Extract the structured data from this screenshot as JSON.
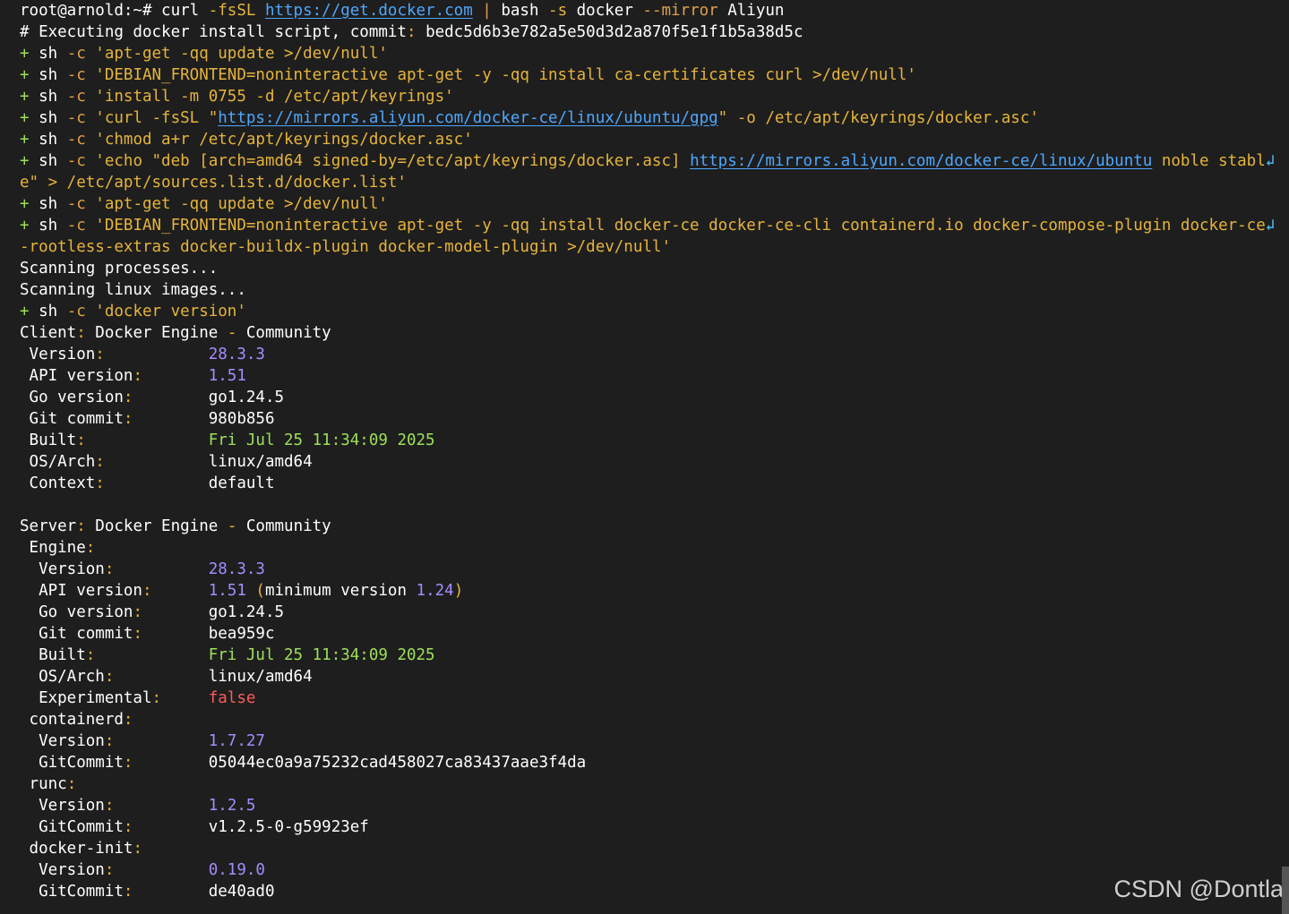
{
  "terminal": {
    "lines": [
      [
        [
          "root@arnold:~# curl ",
          "w"
        ],
        [
          "-fsSL ",
          "g"
        ],
        [
          "https://get.docker.com",
          "ln"
        ],
        [
          " | ",
          "o"
        ],
        [
          "bash ",
          "w"
        ],
        [
          "-s ",
          "g"
        ],
        [
          "docker ",
          "w"
        ],
        [
          "--mirror ",
          "o"
        ],
        [
          "Aliyun",
          "w"
        ]
      ],
      [
        [
          "# Executing docker install script, commit",
          "w"
        ],
        [
          ": ",
          "g"
        ],
        [
          "bedc5d6b3e782a5e50d3d2a870f5e1f1b5a38d5c",
          "w"
        ]
      ],
      [
        [
          "+ ",
          "gr"
        ],
        [
          "sh ",
          "w"
        ],
        [
          "-c ",
          "o"
        ],
        [
          "'apt-get -qq update >/dev/null'",
          "g"
        ]
      ],
      [
        [
          "+ ",
          "gr"
        ],
        [
          "sh ",
          "w"
        ],
        [
          "-c ",
          "o"
        ],
        [
          "'DEBIAN_FRONTEND=noninteractive apt-get -y -qq install ca-certificates curl >/dev/null'",
          "g"
        ]
      ],
      [
        [
          "+ ",
          "gr"
        ],
        [
          "sh ",
          "w"
        ],
        [
          "-c ",
          "o"
        ],
        [
          "'install -m 0755 -d /etc/apt/keyrings'",
          "g"
        ]
      ],
      [
        [
          "+ ",
          "gr"
        ],
        [
          "sh ",
          "w"
        ],
        [
          "-c ",
          "o"
        ],
        [
          "'curl -fsSL \"",
          "g"
        ],
        [
          "https://mirrors.aliyun.com/docker-ce/linux/ubuntu/gpg",
          "ln"
        ],
        [
          "\" -o /etc/apt/keyrings/docker.asc'",
          "g"
        ]
      ],
      [
        [
          "+ ",
          "gr"
        ],
        [
          "sh ",
          "w"
        ],
        [
          "-c ",
          "o"
        ],
        [
          "'chmod a+r /etc/apt/keyrings/docker.asc'",
          "g"
        ]
      ],
      [
        [
          "+ ",
          "gr"
        ],
        [
          "sh ",
          "w"
        ],
        [
          "-c ",
          "o"
        ],
        [
          "'echo \"deb [arch=amd64 signed-by=/etc/apt/keyrings/docker.asc] ",
          "g"
        ],
        [
          "https://mirrors.aliyun.com/docker-ce/linux/ubuntu",
          "ln"
        ],
        [
          " noble stabl",
          "g"
        ],
        [
          "↲",
          "wrapmark"
        ]
      ],
      [
        [
          "e\" > /etc/apt/sources.list.d/docker.list'",
          "g"
        ]
      ],
      [
        [
          "+ ",
          "gr"
        ],
        [
          "sh ",
          "w"
        ],
        [
          "-c ",
          "o"
        ],
        [
          "'apt-get -qq update >/dev/null'",
          "g"
        ]
      ],
      [
        [
          "+ ",
          "gr"
        ],
        [
          "sh ",
          "w"
        ],
        [
          "-c ",
          "o"
        ],
        [
          "'DEBIAN_FRONTEND=noninteractive apt-get -y -qq install docker-ce docker-ce-cli containerd.io docker-compose-plugin docker-ce",
          "g"
        ],
        [
          "↲",
          "wrapmark"
        ]
      ],
      [
        [
          "-rootless-extras docker-buildx-plugin docker-model-plugin >/dev/null'",
          "g"
        ]
      ],
      [
        [
          "Scanning processes...",
          "w"
        ]
      ],
      [
        [
          "Scanning linux images...",
          "w"
        ]
      ],
      [
        [
          "+ ",
          "gr"
        ],
        [
          "sh ",
          "w"
        ],
        [
          "-c ",
          "o"
        ],
        [
          "'docker version'",
          "g"
        ]
      ],
      [
        [
          "Client",
          "w"
        ],
        [
          ": ",
          "g"
        ],
        [
          "Docker Engine ",
          "w"
        ],
        [
          "- ",
          "g"
        ],
        [
          "Community",
          "w"
        ]
      ],
      [
        [
          " Version",
          "w"
        ],
        [
          ":           ",
          "g"
        ],
        [
          "28.3.3",
          "pu"
        ]
      ],
      [
        [
          " API version",
          "w"
        ],
        [
          ":       ",
          "g"
        ],
        [
          "1.51",
          "pu"
        ]
      ],
      [
        [
          " Go version",
          "w"
        ],
        [
          ":        ",
          "g"
        ],
        [
          "go1.24.5",
          "w"
        ]
      ],
      [
        [
          " Git commit",
          "w"
        ],
        [
          ":        ",
          "g"
        ],
        [
          "980b856",
          "w"
        ]
      ],
      [
        [
          " Built",
          "w"
        ],
        [
          ":             ",
          "g"
        ],
        [
          "Fri Jul 25 11:34:09 2025",
          "gr"
        ]
      ],
      [
        [
          " OS/Arch",
          "w"
        ],
        [
          ":           ",
          "g"
        ],
        [
          "linux/amd64",
          "w"
        ]
      ],
      [
        [
          " Context",
          "w"
        ],
        [
          ":           ",
          "g"
        ],
        [
          "default",
          "w"
        ]
      ],
      [
        [
          "",
          "w"
        ]
      ],
      [
        [
          "Server",
          "w"
        ],
        [
          ": ",
          "g"
        ],
        [
          "Docker Engine ",
          "w"
        ],
        [
          "- ",
          "g"
        ],
        [
          "Community",
          "w"
        ]
      ],
      [
        [
          " Engine",
          "w"
        ],
        [
          ":",
          "g"
        ]
      ],
      [
        [
          "  Version",
          "w"
        ],
        [
          ":          ",
          "g"
        ],
        [
          "28.3.3",
          "pu"
        ]
      ],
      [
        [
          "  API version",
          "w"
        ],
        [
          ":      ",
          "g"
        ],
        [
          "1.51 ",
          "pu"
        ],
        [
          "(",
          "g"
        ],
        [
          "minimum version ",
          "w"
        ],
        [
          "1.24",
          "pu"
        ],
        [
          ")",
          "g"
        ]
      ],
      [
        [
          "  Go version",
          "w"
        ],
        [
          ":       ",
          "g"
        ],
        [
          "go1.24.5",
          "w"
        ]
      ],
      [
        [
          "  Git commit",
          "w"
        ],
        [
          ":       ",
          "g"
        ],
        [
          "bea959c",
          "w"
        ]
      ],
      [
        [
          "  Built",
          "w"
        ],
        [
          ":            ",
          "g"
        ],
        [
          "Fri Jul 25 11:34:09 2025",
          "gr"
        ]
      ],
      [
        [
          "  OS/Arch",
          "w"
        ],
        [
          ":          ",
          "g"
        ],
        [
          "linux/amd64",
          "w"
        ]
      ],
      [
        [
          "  Experimental",
          "w"
        ],
        [
          ":     ",
          "g"
        ],
        [
          "false",
          "r"
        ]
      ],
      [
        [
          " containerd",
          "w"
        ],
        [
          ":",
          "g"
        ]
      ],
      [
        [
          "  Version",
          "w"
        ],
        [
          ":          ",
          "g"
        ],
        [
          "1.7.27",
          "pu"
        ]
      ],
      [
        [
          "  GitCommit",
          "w"
        ],
        [
          ":        ",
          "g"
        ],
        [
          "05044ec0a9a75232cad458027ca83437aae3f4da",
          "w"
        ]
      ],
      [
        [
          " runc",
          "w"
        ],
        [
          ":",
          "g"
        ]
      ],
      [
        [
          "  Version",
          "w"
        ],
        [
          ":          ",
          "g"
        ],
        [
          "1.2.5",
          "pu"
        ]
      ],
      [
        [
          "  GitCommit",
          "w"
        ],
        [
          ":        ",
          "g"
        ],
        [
          "v1.2.5-0-g59923ef",
          "w"
        ]
      ],
      [
        [
          " docker-init",
          "w"
        ],
        [
          ":",
          "g"
        ]
      ],
      [
        [
          "  Version",
          "w"
        ],
        [
          ":          ",
          "g"
        ],
        [
          "0.19.0",
          "pu"
        ]
      ],
      [
        [
          "  GitCommit",
          "w"
        ],
        [
          ":        ",
          "g"
        ],
        [
          "de40ad0",
          "w"
        ]
      ]
    ]
  },
  "watermark": "CSDN @Dontla",
  "colors": {
    "background": "#1e1e1e",
    "text": "#ffffff",
    "option": "#e0a04a",
    "string": "#e6b43c",
    "prompt_plus": "#9ee05a",
    "number": "#a58cff",
    "error": "#ff5b5b",
    "link": "#4ea7ff"
  }
}
